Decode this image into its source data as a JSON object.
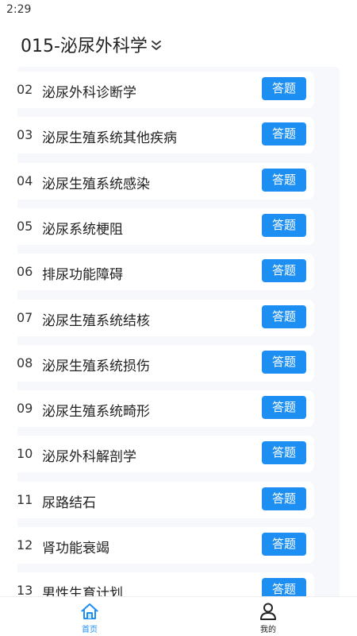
{
  "status": {
    "time": "2:29"
  },
  "header": {
    "title": "015-泌尿外科学"
  },
  "chapters": [
    {
      "num": "02",
      "label": "泌尿外科诊断学",
      "button": "答题"
    },
    {
      "num": "03",
      "label": "泌尿生殖系统其他疾病",
      "button": "答题"
    },
    {
      "num": "04",
      "label": "泌尿生殖系统感染",
      "button": "答题"
    },
    {
      "num": "05",
      "label": "泌尿系统梗阻",
      "button": "答题"
    },
    {
      "num": "06",
      "label": "排尿功能障碍",
      "button": "答题"
    },
    {
      "num": "07",
      "label": "泌尿生殖系统结核",
      "button": "答题"
    },
    {
      "num": "08",
      "label": "泌尿生殖系统损伤",
      "button": "答题"
    },
    {
      "num": "09",
      "label": "泌尿生殖系统畸形",
      "button": "答题"
    },
    {
      "num": "10",
      "label": "泌尿外科解剖学",
      "button": "答题"
    },
    {
      "num": "11",
      "label": "尿路结石",
      "button": "答题"
    },
    {
      "num": "12",
      "label": "肾功能衰竭",
      "button": "答题"
    },
    {
      "num": "13",
      "label": "男性生育计划",
      "button": "答题"
    }
  ],
  "tabbar": {
    "home": {
      "label": "首页",
      "icon": "home-icon",
      "color": "#1e8ff2"
    },
    "mine": {
      "label": "我的",
      "icon": "user-icon",
      "color": "#222222"
    }
  },
  "colors": {
    "accent": "#1e8ff2",
    "panel": "#f6f8fc"
  }
}
